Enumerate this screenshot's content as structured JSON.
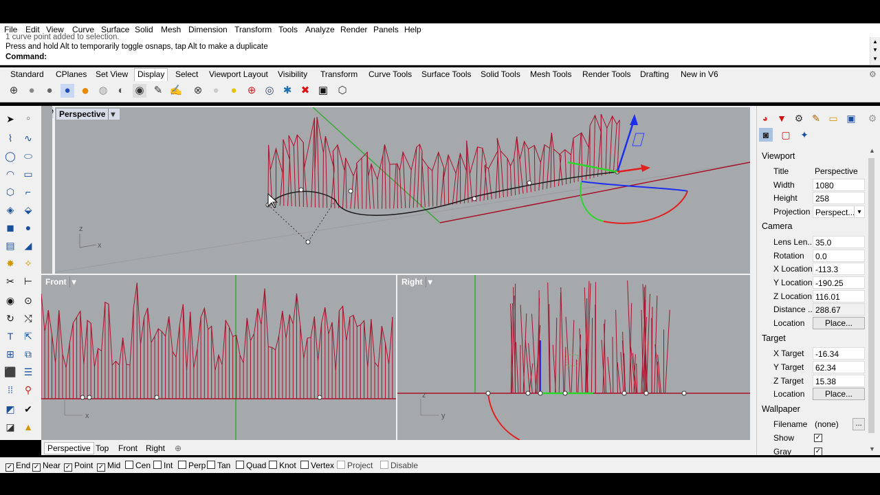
{
  "menu": [
    "File",
    "Edit",
    "View",
    "Curve",
    "Surface",
    "Solid",
    "Mesh",
    "Dimension",
    "Transform",
    "Tools",
    "Analyze",
    "Render",
    "Panels",
    "Help"
  ],
  "command": {
    "history_partial": "1 curve point added to selection.",
    "history": "Press and hold Alt to temporarily toggle osnaps, tap Alt to make a duplicate",
    "prompt": "Command:"
  },
  "toolbar_tabs": [
    "Standard",
    "CPlanes",
    "Set View",
    "Display",
    "Select",
    "Viewport Layout",
    "Visibility",
    "Transform",
    "Curve Tools",
    "Surface Tools",
    "Solid Tools",
    "Mesh Tools",
    "Render Tools",
    "Drafting",
    "New in V6"
  ],
  "active_tab": "Display",
  "toolbar_icons": [
    "wireframe-globe-icon",
    "shaded-sphere-icon",
    "rendered-sphere-icon",
    "ghosted-sphere-icon",
    "gold-sphere-icon",
    "xray-sphere-icon",
    "technical-icon",
    "artistic-icon",
    "pen-icon",
    "monochrome-icon",
    "sphere-grid-icon",
    "white-sphere-icon",
    "yellow-sphere-icon",
    "target-icon",
    "eye-icon",
    "lights-icon",
    "no-lights-icon",
    "monitor-icon",
    "cube-icon"
  ],
  "viewports": {
    "perspective": {
      "title": "Perspective",
      "clipped_label": "Te"
    },
    "front": {
      "title": "Front"
    },
    "right": {
      "title": "Right"
    }
  },
  "viewport_tabs": [
    "Perspective",
    "Top",
    "Front",
    "Right"
  ],
  "active_viewport_tab": "Perspective",
  "axes": {
    "z": "z",
    "x": "x",
    "y": "y"
  },
  "osnaps": [
    {
      "label": "End",
      "checked": true
    },
    {
      "label": "Near",
      "checked": true
    },
    {
      "label": "Point",
      "checked": true
    },
    {
      "label": "Mid",
      "checked": true
    },
    {
      "label": "Cen",
      "checked": false
    },
    {
      "label": "Int",
      "checked": false
    },
    {
      "label": "Perp",
      "checked": false
    },
    {
      "label": "Tan",
      "checked": false
    },
    {
      "label": "Quad",
      "checked": false
    },
    {
      "label": "Knot",
      "checked": false
    },
    {
      "label": "Vertex",
      "checked": false
    },
    {
      "label": "Project",
      "checked": false
    },
    {
      "label": "Disable",
      "checked": false
    }
  ],
  "properties": {
    "viewport_header": "Viewport",
    "title_label": "Title",
    "title_value": "Perspective",
    "width_label": "Width",
    "width_value": "1080",
    "height_label": "Height",
    "height_value": "258",
    "projection_label": "Projection",
    "projection_value": "Perspect...",
    "camera_header": "Camera",
    "lens_label": "Lens Len...",
    "lens_value": "35.0",
    "rotation_label": "Rotation",
    "rotation_value": "0.0",
    "xloc_label": "X Location",
    "xloc_value": "-113.3",
    "yloc_label": "Y Location",
    "yloc_value": "-190.25",
    "zloc_label": "Z Location",
    "zloc_value": "116.01",
    "distance_label": "Distance ...",
    "distance_value": "288.67",
    "location_label": "Location",
    "place_button": "Place...",
    "target_header": "Target",
    "xtarget_label": "X Target",
    "xtarget_value": "-16.34",
    "ytarget_label": "Y Target",
    "ytarget_value": "62.34",
    "ztarget_label": "Z Target",
    "ztarget_value": "15.38",
    "target_location_label": "Location",
    "target_place_button": "Place...",
    "wallpaper_header": "Wallpaper",
    "filename_label": "Filename",
    "filename_value": "(none)",
    "browse_button": "...",
    "show_label": "Show",
    "show_checked": true,
    "gray_label": "Gray",
    "gray_checked": true
  },
  "colors": {
    "curve_red": "#a8102a",
    "gumball_blue": "#1c2ff0",
    "gumball_green": "#2bd62b",
    "gumball_red": "#e0201e",
    "viewport_bg": "#a6a9ac"
  }
}
